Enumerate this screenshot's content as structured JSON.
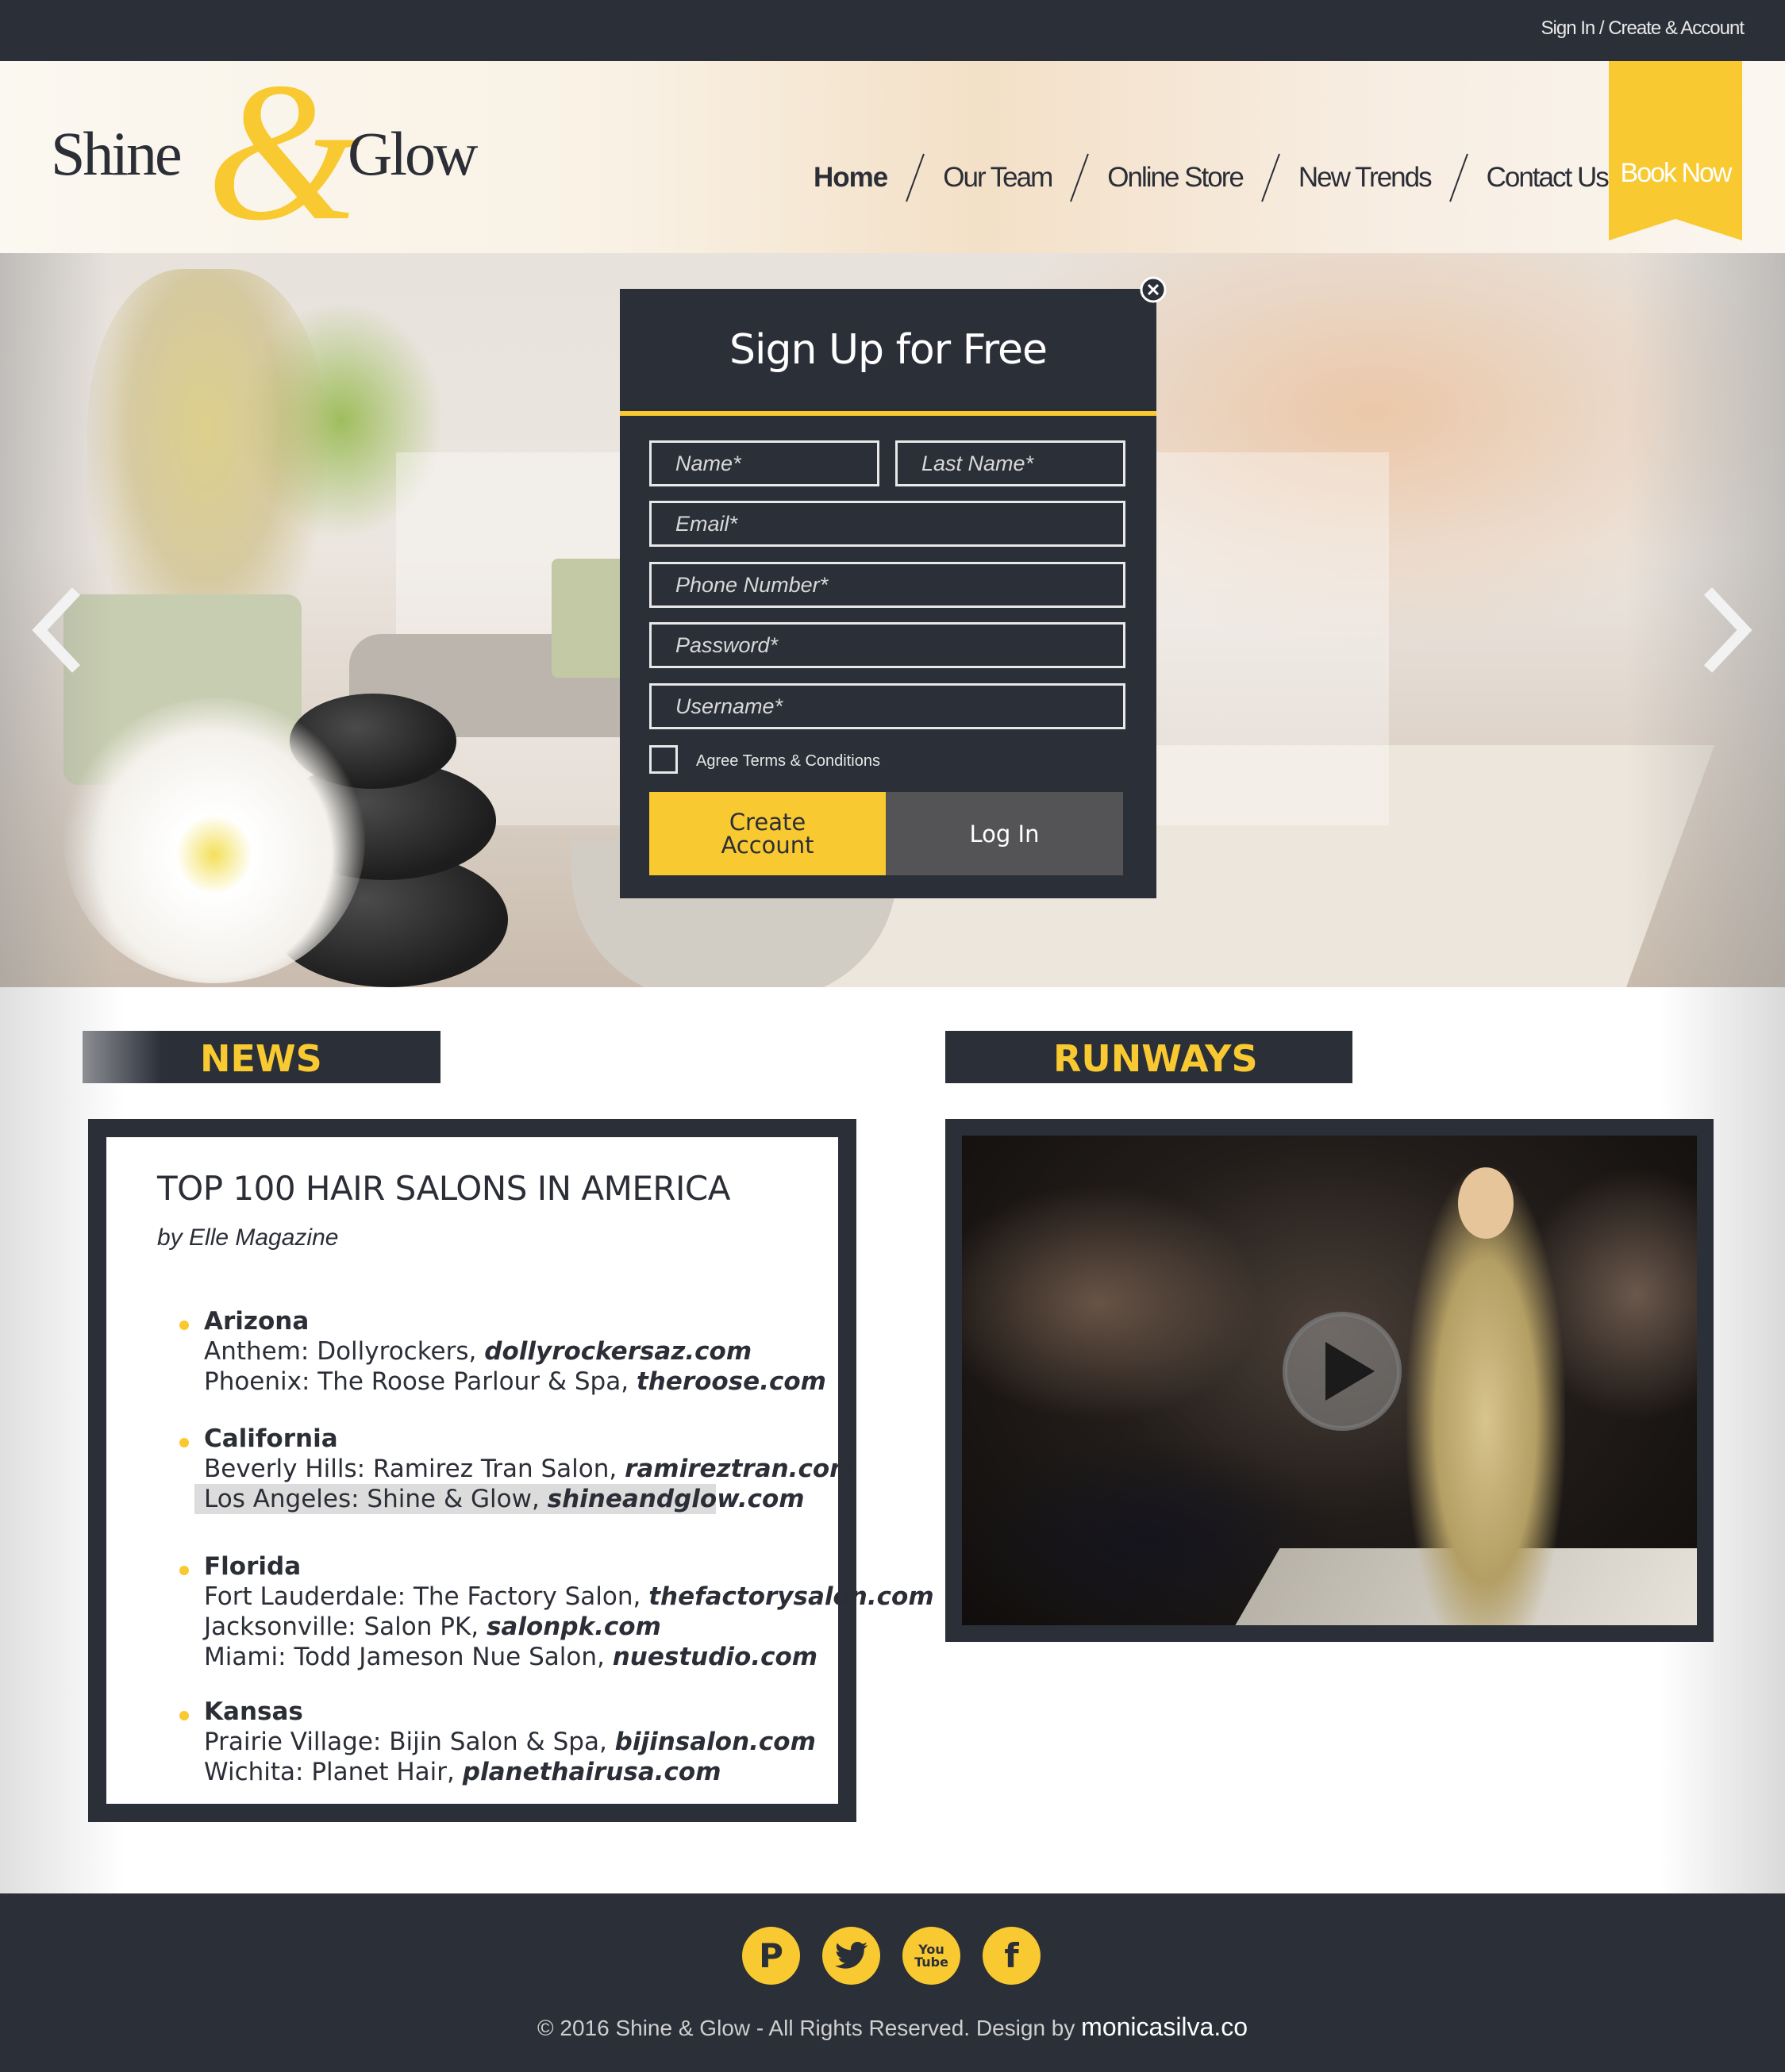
{
  "topbar": {
    "auth_link": "Sign In / Create & Account"
  },
  "logo": {
    "word1": "Shine",
    "ampersand": "&",
    "word2": "Glow"
  },
  "nav": {
    "items": [
      {
        "label": "Home"
      },
      {
        "label": "Our Team"
      },
      {
        "label": "Online Store"
      },
      {
        "label": "New Trends"
      },
      {
        "label": "Contact Us"
      }
    ],
    "active": "Home",
    "book_now": "Book Now"
  },
  "signup": {
    "title": "Sign Up for Free",
    "fields": {
      "name": "Name*",
      "last_name": "Last Name*",
      "email": "Email*",
      "phone": "Phone Number*",
      "password": "Password*",
      "username": "Username*"
    },
    "terms_label": "Agree Terms & Conditions",
    "terms_checked": false,
    "create_label": "Create Account",
    "login_label": "Log In"
  },
  "news": {
    "tab_label": "NEWS",
    "title": "TOP 100 HAIR SALONS IN AMERICA",
    "byline": "by Elle Magazine",
    "states": [
      {
        "name": "Arizona",
        "entries": [
          {
            "text": "Anthem: Dollyrockers",
            "sep": ", ",
            "link": "dollyrockersaz.com"
          },
          {
            "text": "Phoenix: The Roose Parlour & Spa",
            "sep": ", ",
            "link": "theroose.com"
          }
        ]
      },
      {
        "name": "California",
        "entries": [
          {
            "text": "Beverly Hills: Ramirez Tran Salon",
            "sep": ", ",
            "link": "ramireztran.com"
          },
          {
            "text": "Los Angeles: Shine & Glow",
            "sep": ", ",
            "link": "shineandglow.com"
          }
        ]
      },
      {
        "name": "Florida",
        "entries": [
          {
            "text": "Fort Lauderdale: The Factory Salon",
            "sep": ", ",
            "link": "thefactorysalon.com"
          },
          {
            "text": "Jacksonville: Salon PK",
            "sep": ", ",
            "link": "salonpk.com"
          },
          {
            "text": "Miami: Todd Jameson Nue Salon",
            "sep": ", ",
            "link": "nuestudio.com"
          }
        ]
      },
      {
        "name": "Kansas",
        "entries": [
          {
            "text": "Prairie Village: Bijin Salon & Spa",
            "sep": ", ",
            "link": "bijinsalon.com"
          },
          {
            "text": "Wichita: Planet Hair",
            "sep": ", ",
            "link": "planethairusa.com"
          }
        ]
      }
    ]
  },
  "runways": {
    "tab_label": "RUNWAYS"
  },
  "footer": {
    "social": [
      {
        "name": "pinterest-icon",
        "glyph": "P"
      },
      {
        "name": "twitter-icon",
        "glyph": "t"
      },
      {
        "name": "youtube-icon",
        "glyph1": "You",
        "glyph2": "Tube"
      },
      {
        "name": "facebook-icon",
        "glyph": "f"
      }
    ],
    "copyright": "© 2016 Shine & Glow - All Rights Reserved. Design by ",
    "credit": "monicasilva.co"
  },
  "colors": {
    "brand_yellow": "#f8c930",
    "dark": "#2b2f38",
    "login_gray": "#545456"
  }
}
